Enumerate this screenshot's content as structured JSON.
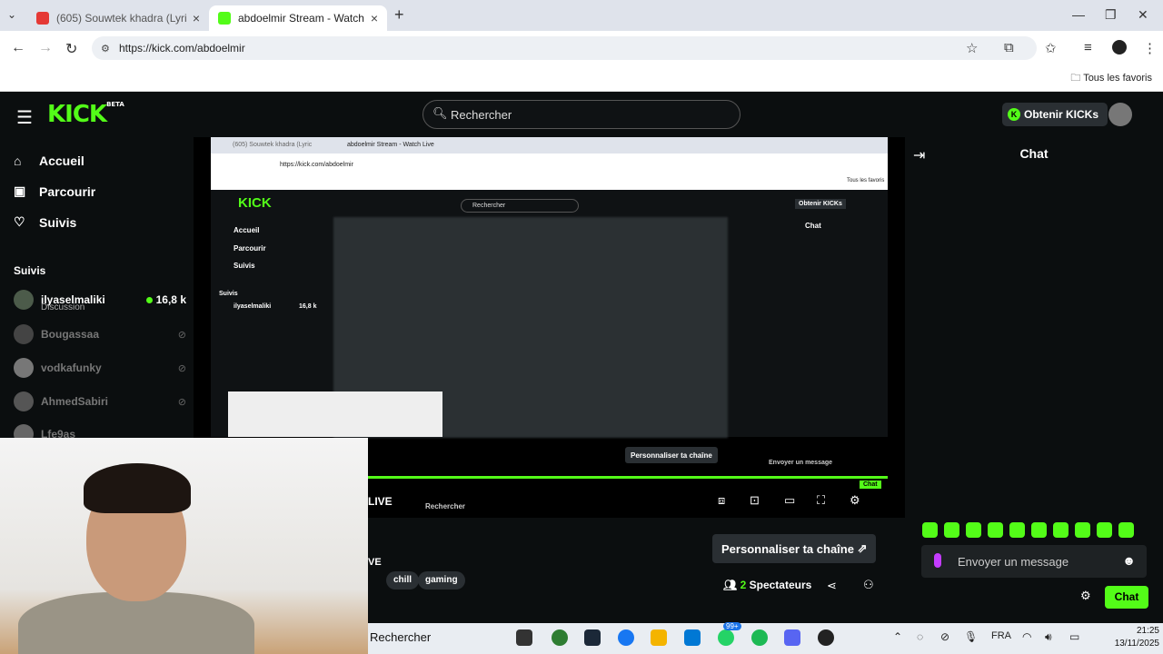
{
  "browser": {
    "tabs": [
      {
        "title": "(605) Souwtek khadra (Lyric",
        "active": false
      },
      {
        "title": "abdoelmir Stream - Watch Live",
        "active": true
      }
    ],
    "url": "https://kick.com/abdoelmir",
    "bookmarks_all": "Tous les favoris"
  },
  "kick": {
    "logo": "KICK",
    "logo_badge": "BETA",
    "search_placeholder": "Rechercher",
    "kicks_button": "Obtenir KICKs",
    "nav": [
      "Accueil",
      "Parcourir",
      "Suivis"
    ],
    "follows_heading": "Suivis",
    "follows": [
      {
        "name": "ilyaselmaliki",
        "category": "Discussion",
        "viewers": "16,8 k",
        "live": true
      },
      {
        "name": "Bougassaa",
        "live": false
      },
      {
        "name": "vodkafunky",
        "live": false
      },
      {
        "name": "AhmedSabiri",
        "live": false
      },
      {
        "name": "Lfe9as",
        "live": false
      }
    ],
    "player": {
      "inner_customize": "Personnaliser ta chaîne",
      "inner_message": "Envoyer un message",
      "inner_chat": "Chat",
      "inner_search": "Rechercher",
      "inner_live": "LIVE"
    },
    "chat": {
      "title": "Chat",
      "message_placeholder": "Envoyer un message",
      "chat_button": "Chat"
    },
    "stream_info": {
      "customize_button": "Personnaliser ta chaîne",
      "tags": [
        "chill",
        "gaming"
      ],
      "viewers_count": "2",
      "viewers_label": "Spectateurs",
      "ve_fragment": "VE"
    }
  },
  "taskbar": {
    "search": "Rechercher",
    "badge_whatsapp": "99+",
    "lang": "FRA",
    "time": "21:25",
    "date": "13/11/2025"
  },
  "colors": {
    "brand": "#53fc18",
    "bg": "#0b0e0f",
    "mic": "#c43cff"
  }
}
